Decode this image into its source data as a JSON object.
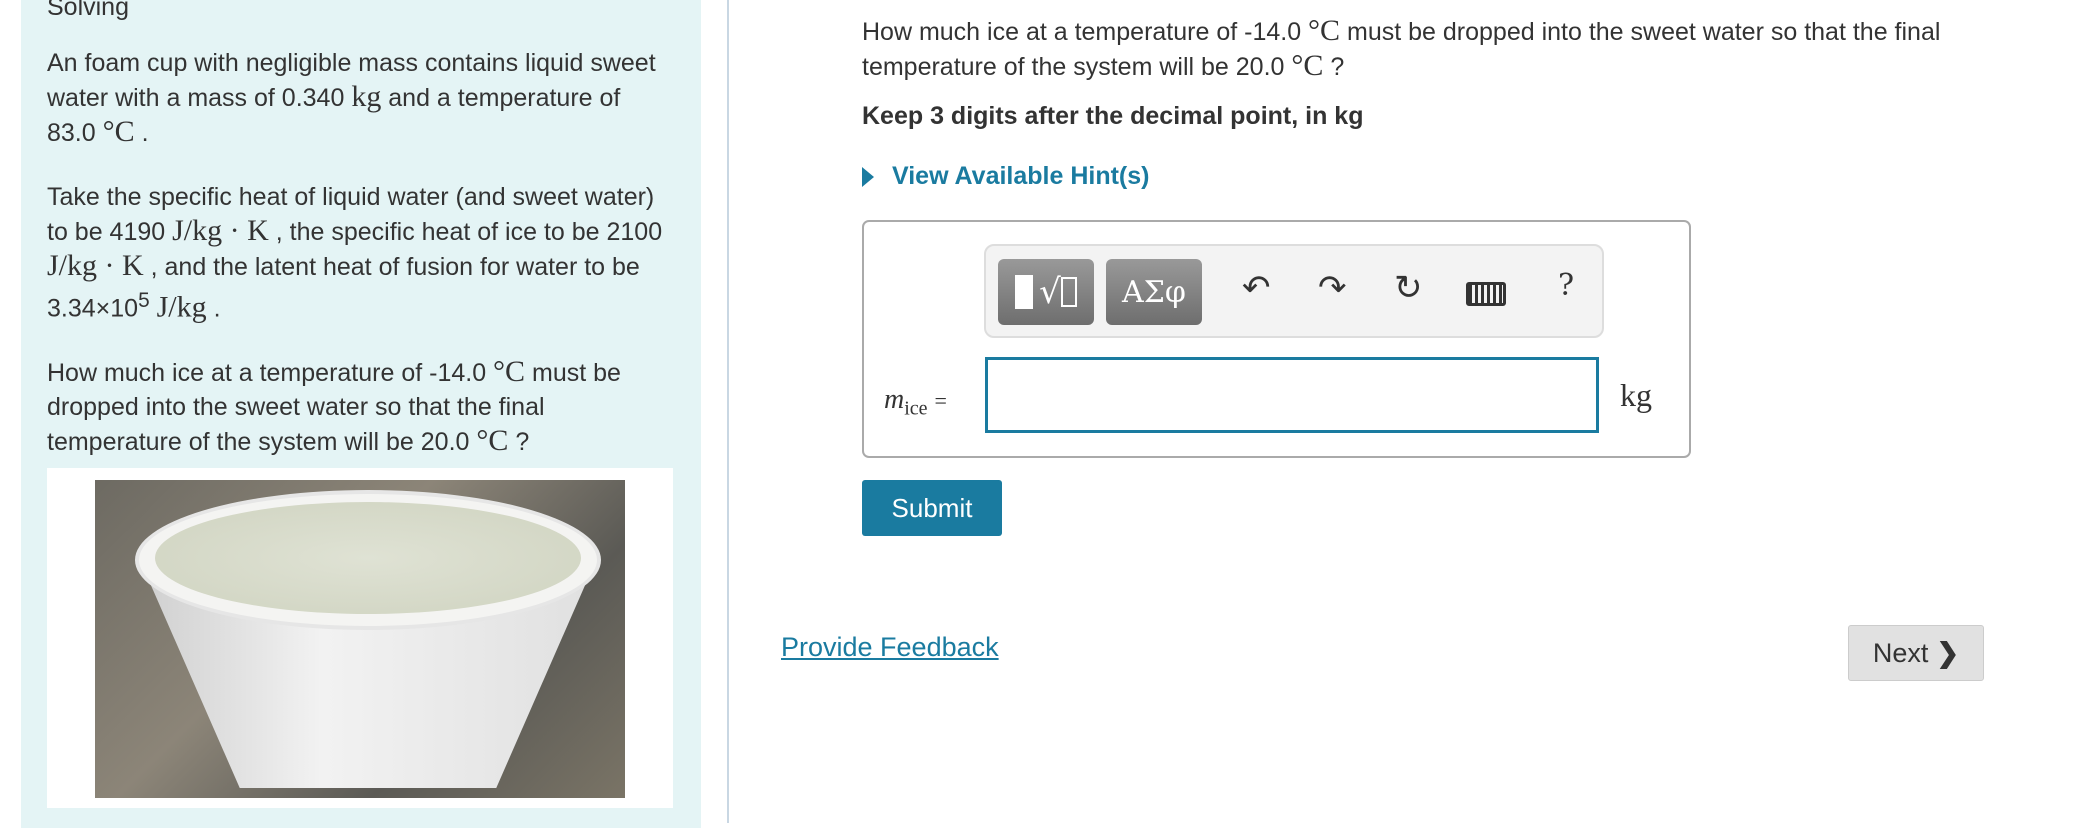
{
  "left_panel": {
    "section_title": "Solving",
    "para1": [
      "An foam cup with negligible mass contains liquid sweet water with a mass of 0.340 ",
      "kg",
      " and a temperature of 83.0 ",
      "°C",
      " ."
    ],
    "para2": [
      "Take the specific heat of liquid water (and sweet water) to be 4190 ",
      "J/kg · K",
      " , the specific heat of ice to be 2100 ",
      "J/kg · K",
      " , and the latent heat of fusion for water to be 3.34×10",
      "5",
      " ",
      "J/kg",
      " ."
    ],
    "para3": [
      "How much ice at a temperature of -14.0 ",
      "°C",
      " must be dropped into the sweet water so that the final temperature of the system will be 20.0 ",
      "°C",
      " ?"
    ]
  },
  "main": {
    "question": [
      "How much ice at a temperature of -14.0 ",
      "°C",
      " must be dropped into the sweet water so that the final temperature of the system will be 20.0 ",
      "°C",
      " ?"
    ],
    "instruction": "Keep 3 digits after the decimal point, in kg",
    "hint_link": "View Available Hint(s)",
    "toolbar": {
      "templates_label": "√",
      "symbols_label": "ΑΣφ",
      "help_label": "?"
    },
    "answer": {
      "variable": "m",
      "subscript": "ice",
      "equals": "=",
      "value": "",
      "unit": "kg"
    },
    "submit_label": "Submit",
    "feedback_link": "Provide Feedback",
    "next_label": "Next"
  },
  "colors": {
    "accent": "#1a7ba0",
    "panel_bg": "#e4f4f5"
  }
}
